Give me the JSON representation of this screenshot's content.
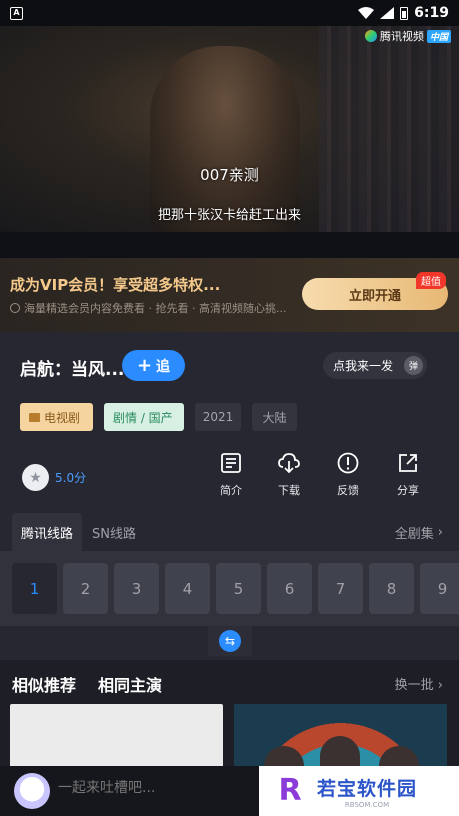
{
  "status_bar": {
    "app_icon": "A",
    "time": "6:19"
  },
  "player": {
    "logo_text": "腾讯视频",
    "logo_tag": "中国",
    "subtitle_top": "007亲测",
    "subtitle_bottom": "把那十张汉卡给赶工出来"
  },
  "vip": {
    "title": "成为VIP会员！享受超多特权...",
    "subtitle": "海量精选会员内容免费看 · 抢先看 · 高清视频随心挑...",
    "button": "立即开通",
    "badge": "超值"
  },
  "show": {
    "title": "启航：当风...",
    "follow_label": "追",
    "comment_pill": "点我来一发",
    "pill_avatar": "弹",
    "tags": {
      "type": "电视剧",
      "genre": "剧情 / 国产",
      "year": "2021",
      "region": "大陆"
    },
    "rating": "5.0分"
  },
  "actions": {
    "intro": "简介",
    "download": "下载",
    "feedback": "反馈",
    "share": "分享"
  },
  "routes": {
    "active": "腾讯线路",
    "other": "SN线路",
    "all_episodes": "全剧集"
  },
  "episodes": [
    "1",
    "2",
    "3",
    "4",
    "5",
    "6",
    "7",
    "8",
    "9"
  ],
  "recommend": {
    "tab_similar": "相似推荐",
    "tab_cast": "相同主演",
    "refresh": "换一批"
  },
  "comment": {
    "placeholder": "一起来吐槽吧..."
  },
  "watermark": {
    "title": "若宝软件园",
    "sub": "RBSOM.COM"
  },
  "colors": {
    "accent": "#2a8cff",
    "vip_gold": "#f4c98b",
    "badge_red": "#f2362a"
  }
}
